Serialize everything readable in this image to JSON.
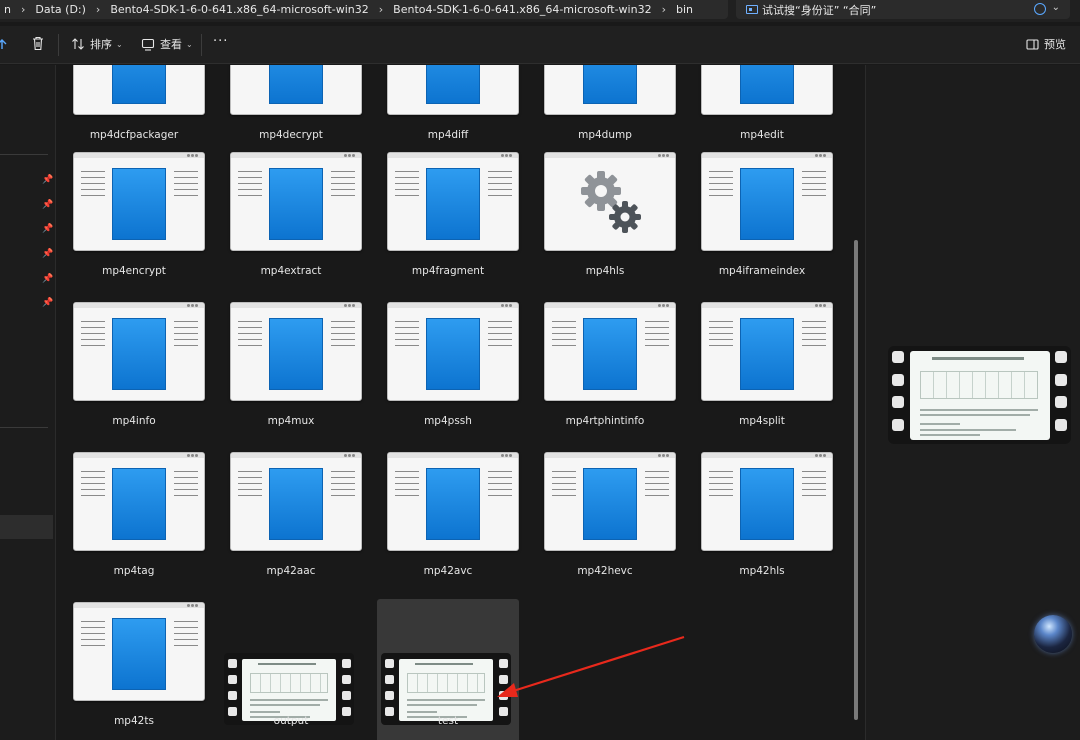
{
  "address": {
    "lead": "n",
    "segments": [
      "Data (D:)",
      "Bento4-SDK-1-6-0-641.x86_64-microsoft-win32",
      "Bento4-SDK-1-6-0-641.x86_64-microsoft-win32",
      "bin"
    ]
  },
  "search": {
    "value": "试试搜“身份证” “合同”"
  },
  "toolbar": {
    "sort_label": "排序",
    "view_label": "查看",
    "more_label": "···",
    "preview_label": "预览"
  },
  "files": [
    {
      "name": "mp4dcfpackager",
      "type": "app"
    },
    {
      "name": "mp4decrypt",
      "type": "app"
    },
    {
      "name": "mp4diff",
      "type": "app"
    },
    {
      "name": "mp4dump",
      "type": "app"
    },
    {
      "name": "mp4edit",
      "type": "app"
    },
    {
      "name": "mp4encrypt",
      "type": "app"
    },
    {
      "name": "mp4extract",
      "type": "app"
    },
    {
      "name": "mp4fragment",
      "type": "app"
    },
    {
      "name": "mp4hls",
      "type": "settings"
    },
    {
      "name": "mp4iframeindex",
      "type": "app"
    },
    {
      "name": "mp4info",
      "type": "app"
    },
    {
      "name": "mp4mux",
      "type": "app"
    },
    {
      "name": "mp4pssh",
      "type": "app"
    },
    {
      "name": "mp4rtphintinfo",
      "type": "app"
    },
    {
      "name": "mp4split",
      "type": "app"
    },
    {
      "name": "mp4tag",
      "type": "app"
    },
    {
      "name": "mp42aac",
      "type": "app"
    },
    {
      "name": "mp42avc",
      "type": "app"
    },
    {
      "name": "mp42hevc",
      "type": "app"
    },
    {
      "name": "mp42hls",
      "type": "app"
    },
    {
      "name": "mp42ts",
      "type": "app"
    },
    {
      "name": "output",
      "type": "video"
    },
    {
      "name": "test",
      "type": "video",
      "selected": true
    }
  ],
  "colors": {
    "accent_blue": "#0d74d0",
    "arrow_red": "#e8291c",
    "selection": "#383838"
  }
}
